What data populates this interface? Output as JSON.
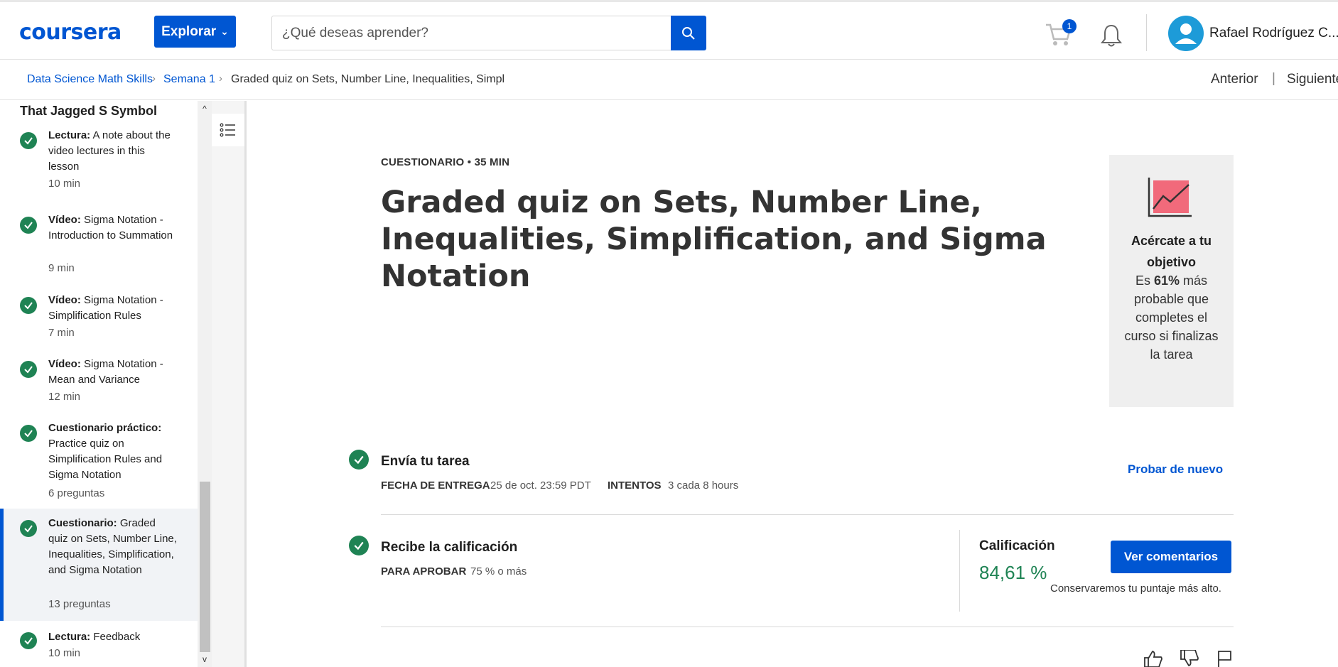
{
  "header": {
    "logo": "coursera",
    "explore_label": "Explorar",
    "search_placeholder": "¿Qué deseas aprender?",
    "cart_count": "1",
    "user_name": "Rafael Rodríguez C..."
  },
  "breadcrumb": {
    "items": [
      "Data Science Math Skills",
      "Semana 1",
      "Graded quiz on Sets, Number Line, Inequalities, Simpl"
    ],
    "prev_label": "Anterior",
    "next_label": "Siguiente"
  },
  "sidebar": {
    "section_title": "That Jagged S Symbol",
    "items": [
      {
        "kind": "Lectura:",
        "title": "A note about the video lectures in this lesson",
        "meta": "10 min",
        "completed": true,
        "active": false
      },
      {
        "kind": "Vídeo:",
        "title": "Sigma Notation - Introduction to Summation",
        "meta": "9 min",
        "completed": true,
        "active": false
      },
      {
        "kind": "Vídeo:",
        "title": "Sigma Notation - Simplification Rules",
        "meta": "7 min",
        "completed": true,
        "active": false
      },
      {
        "kind": "Vídeo:",
        "title": "Sigma Notation - Mean and Variance",
        "meta": "12 min",
        "completed": true,
        "active": false
      },
      {
        "kind": "Cuestionario práctico:",
        "title": "Practice quiz on Simplification Rules and Sigma Notation",
        "meta": "6 preguntas",
        "completed": true,
        "active": false
      },
      {
        "kind": "Cuestionario:",
        "title": "Graded quiz on Sets, Number Line, Inequalities, Simplification, and Sigma Notation",
        "meta": "13 preguntas",
        "completed": true,
        "active": true
      },
      {
        "kind": "Lectura:",
        "title": "Feedback",
        "meta": "10 min",
        "completed": true,
        "active": false
      }
    ]
  },
  "main": {
    "type_label": "CUESTIONARIO • 35 MIN",
    "title": "Graded quiz on Sets, Number Line, Inequalities, Simplification, and Sigma Notation",
    "goal": {
      "heading": "Acércate a tu objetivo",
      "body_prefix": "Es",
      "percent": "61%",
      "body_suffix": "más probable que completes el curso si finalizas la tarea"
    },
    "submit_step": {
      "title": "Envía tu tarea",
      "due_label": "FECHA DE ENTREGA",
      "due_value": "25 de oct. 23:59 PDT",
      "attempts_label": "INTENTOS",
      "attempts_value": "3 cada 8 hours",
      "retry_label": "Probar de nuevo"
    },
    "grade_step": {
      "title": "Recibe la calificación",
      "pass_label": "PARA APROBAR",
      "pass_value": "75 % o más",
      "grade_label": "Calificación",
      "grade_value": "84,61 %",
      "feedback_button": "Ver comentarios",
      "keep_note": "Conservaremos tu puntaje más alto."
    }
  },
  "colors": {
    "brand": "#0056d2",
    "success": "#1f8354",
    "goal_chart": "#f16a7b"
  }
}
